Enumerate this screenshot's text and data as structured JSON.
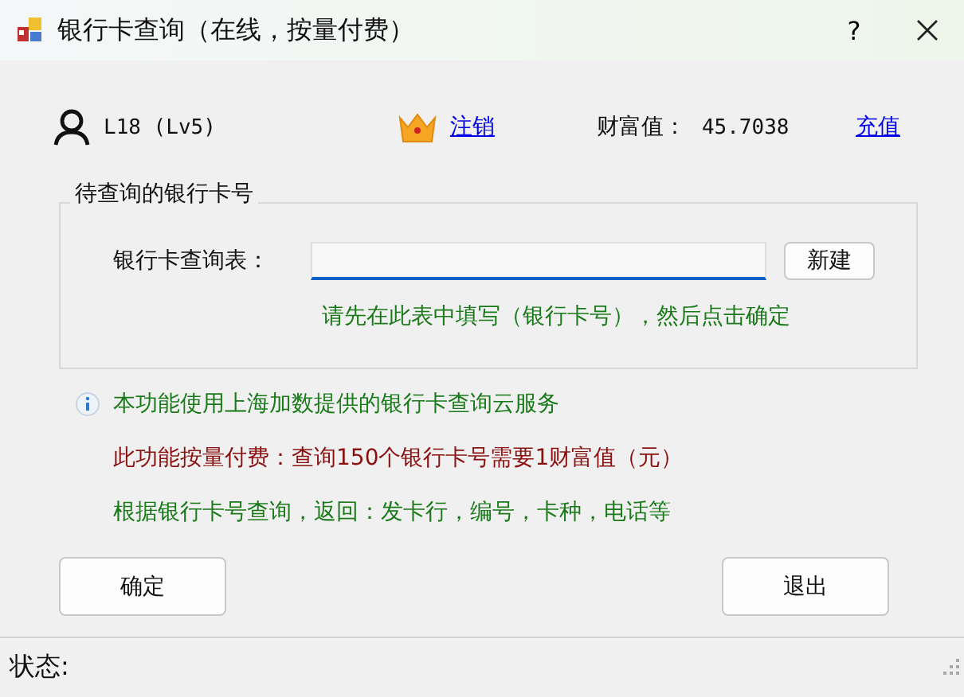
{
  "window": {
    "title": "银行卡查询（在线，按量付费）",
    "help": "?"
  },
  "account": {
    "user": "L18 (Lv5)",
    "logout": "注销",
    "wealth_label": "财富值：",
    "wealth_value": "45.7038",
    "recharge": "充值"
  },
  "group": {
    "title": "待查询的银行卡号",
    "field_label": "银行卡查询表：",
    "new_button": "新建",
    "hint": "请先在此表中填写（银行卡号），然后点击确定"
  },
  "notes": [
    {
      "kind": "info",
      "text": "本功能使用上海加数提供的银行卡查询云服务",
      "color": "#1a7a1a"
    },
    {
      "kind": "plain",
      "text": "此功能按量付费：查询150个银行卡号需要1财富值（元）",
      "color": "#8b1010"
    },
    {
      "kind": "plain",
      "text": "根据银行卡号查询，返回：发卡行，编号，卡种，电话等",
      "color": "#1a7a1a"
    }
  ],
  "buttons": [
    "确定",
    "退出"
  ],
  "status_bar": {
    "label": "状态:"
  }
}
